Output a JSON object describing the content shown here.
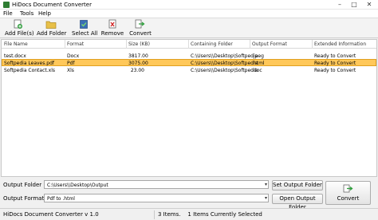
{
  "window": {
    "title": "HiDocs Document Converter"
  },
  "menu": {
    "items": [
      "File",
      "Tools",
      "Help"
    ]
  },
  "toolbar": {
    "add_files": "Add File(s)",
    "add_folder": "Add Folder",
    "select_all": "Select All",
    "remove": "Remove",
    "convert": "Convert"
  },
  "table": {
    "headers": [
      "File Name",
      "Format",
      "Size (KB)",
      "Containing Folder",
      "Output Format",
      "Extended Information"
    ],
    "rows": [
      [
        "test.docx",
        "Docx",
        "3817.00",
        "C:\\Users\\\\Desktop\\Softpedia",
        ".jpeg",
        "Ready to Convert"
      ],
      [
        "Softpedia Leaves.pdf",
        "Pdf",
        "3075.00",
        "C:\\Users\\\\Desktop\\Softpedia",
        ".html",
        "Ready to Convert"
      ],
      [
        "Softpedia Contact.xls",
        "Xls",
        "23.00",
        "C:\\Users\\\\Desktop\\Softpedia",
        ".doc",
        "Ready to Convert"
      ]
    ],
    "selected_row": 1
  },
  "output": {
    "folder_label": "Output Folder :",
    "folder_value": "C:\\Users\\\\Desktop\\Output",
    "format_label": "Output Format :",
    "format_value": "Pdf to .html",
    "set_folder_button": "Set Output Folder",
    "open_folder_button": "Open Output Folder",
    "convert_button": "Convert"
  },
  "status": {
    "app_version": "HiDocs Document Converter v 1.0",
    "summary": "3 Items.    1 Items Currently Selected"
  },
  "colors": {
    "selection": "#ffc85a",
    "accent_green": "#2e7d32"
  }
}
